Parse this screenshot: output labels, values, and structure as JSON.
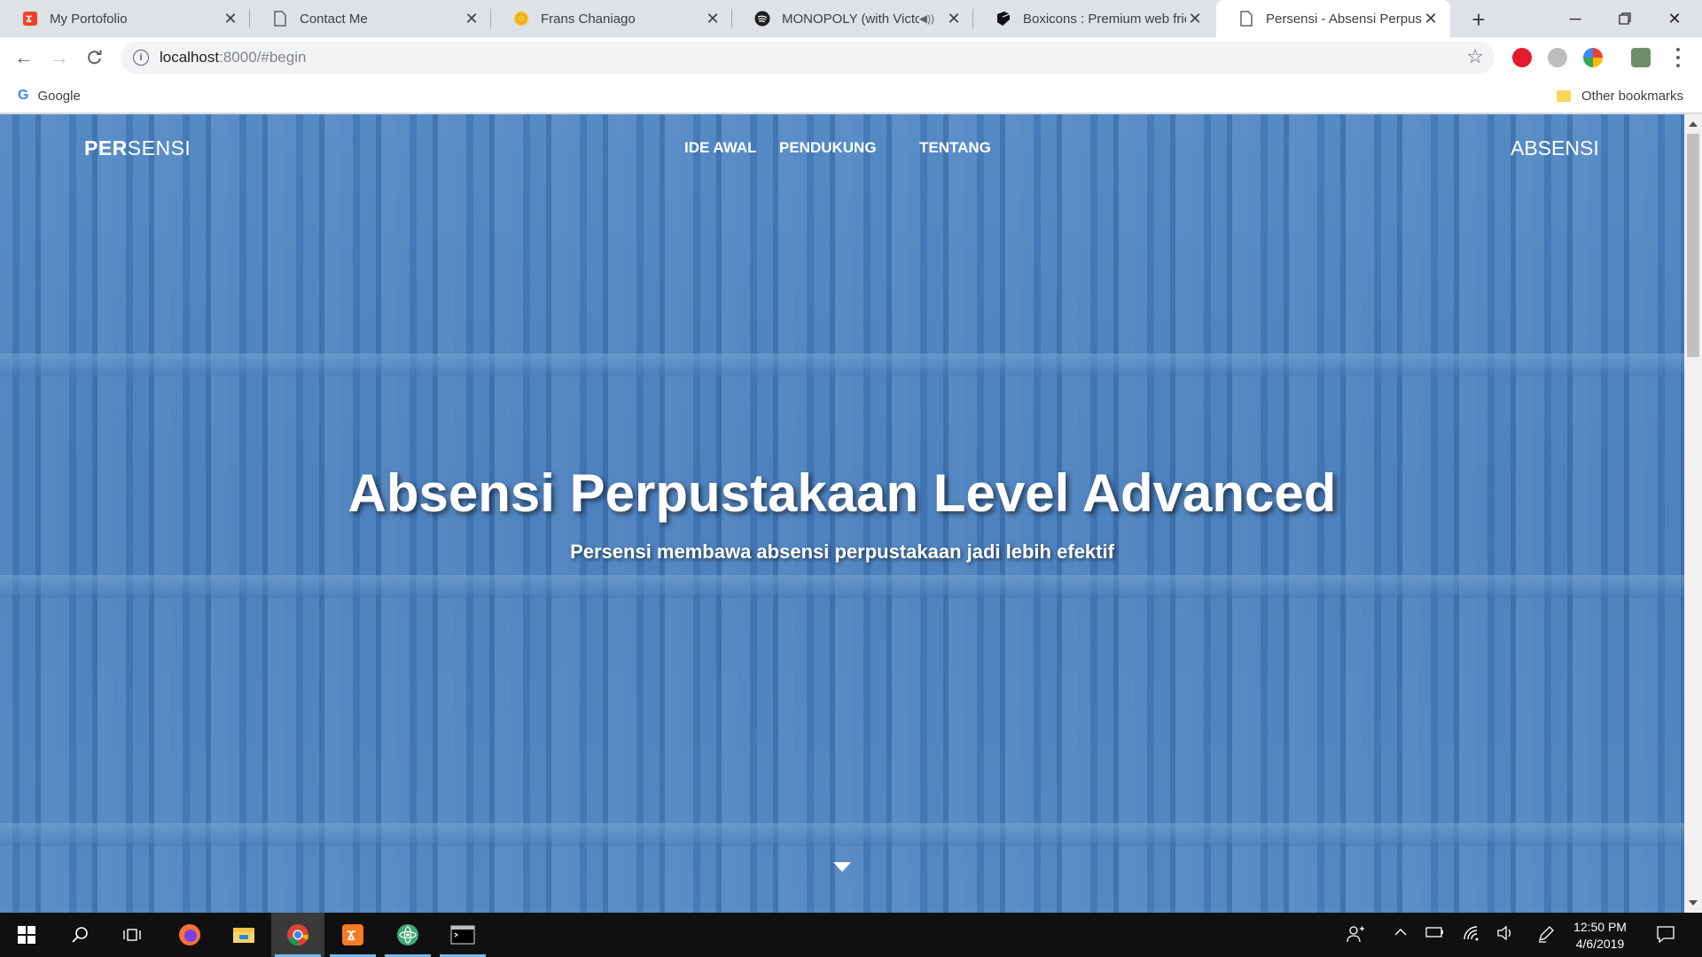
{
  "browser": {
    "tabs": [
      {
        "title": "My Portofolio",
        "favicon": "codeigniter-logo-icon",
        "active": false
      },
      {
        "title": "Contact Me",
        "favicon": "page-icon",
        "active": false
      },
      {
        "title": "Frans Chaniago",
        "favicon": "emoji-face-icon",
        "active": false
      },
      {
        "title": "MONOPOLY (with Victor",
        "favicon": "spotify-icon",
        "active": false,
        "playing_audio": true
      },
      {
        "title": "Boxicons : Premium web frie",
        "favicon": "boxicons-logo-icon",
        "active": false
      },
      {
        "title": "Persensi - Absensi Perpustak",
        "favicon": "page-icon",
        "active": true
      }
    ],
    "address": {
      "host": "localhost",
      "path": ":8000/#begin"
    },
    "bookmarks": {
      "google": "Google",
      "other": "Other bookmarks"
    }
  },
  "site": {
    "brand_bold": "PER",
    "brand_light": "SENSI",
    "nav": [
      "IDE AWAL",
      "PENDUKUNG",
      "TENTANG"
    ],
    "cta": "ABSENSI",
    "hero_title": "Absensi Perpustakaan Level Advanced",
    "hero_subtitle": "Persensi membawa absensi perpustakaan jadi lebih efektif"
  },
  "taskbar": {
    "clock_time": "12:50 PM",
    "clock_date": "4/6/2019"
  },
  "colors": {
    "hero_overlay": "#3a78c4",
    "tab_strip": "#dee1e6",
    "taskbar": "#101010"
  }
}
